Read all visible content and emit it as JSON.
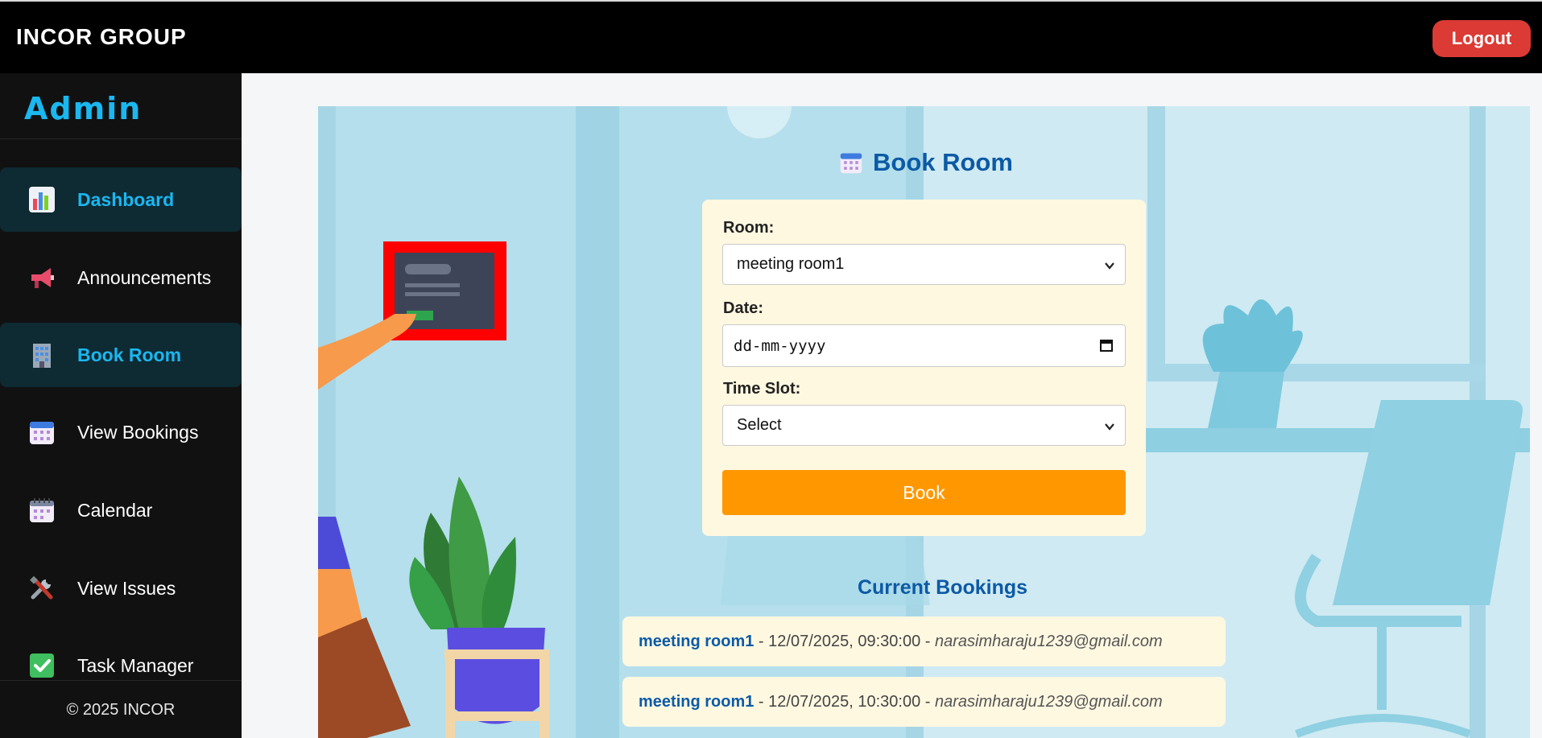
{
  "topbar": {
    "brand": "INCOR GROUP",
    "logout_label": "Logout"
  },
  "sidebar": {
    "title": "Admin",
    "items": [
      {
        "label": "Dashboard",
        "icon": "bar-chart-icon",
        "active": true
      },
      {
        "label": "Announcements",
        "icon": "megaphone-icon",
        "active": false
      },
      {
        "label": "Book Room",
        "icon": "office-building-icon",
        "active": true
      },
      {
        "label": "View Bookings",
        "icon": "calendar-icon",
        "active": false
      },
      {
        "label": "Calendar",
        "icon": "spiral-calendar-icon",
        "active": false
      },
      {
        "label": "View Issues",
        "icon": "tools-icon",
        "active": false
      },
      {
        "label": "Task Manager",
        "icon": "check-mark-icon",
        "active": false
      }
    ],
    "footer": "© 2025 INCOR"
  },
  "main": {
    "title": "Book Room",
    "form": {
      "room_label": "Room:",
      "room_value": "meeting room1",
      "date_label": "Date:",
      "date_placeholder": "dd-mm-yyyy",
      "slot_label": "Time Slot:",
      "slot_value": "Select",
      "book_label": "Book"
    },
    "current_bookings_title": "Current Bookings",
    "bookings": [
      {
        "room": "meeting room1",
        "sep1": " - ",
        "datetime": "12/07/2025, 09:30:00",
        "sep2": " - ",
        "email": "narasimharaju1239@gmail.com"
      },
      {
        "room": "meeting room1",
        "sep1": " - ",
        "datetime": "12/07/2025, 10:30:00",
        "sep2": " - ",
        "email": "narasimharaju1239@gmail.com"
      }
    ]
  },
  "colors": {
    "accent": "#1ab7f0",
    "logout": "#dc3a35",
    "book_button": "#ff9800",
    "title_blue": "#0c5aa6",
    "card_bg": "#fff8e1"
  }
}
